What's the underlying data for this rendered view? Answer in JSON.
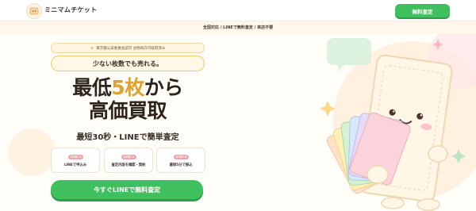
{
  "header": {
    "brand": "ミニマムチケット",
    "cta_label": "無料査定"
  },
  "subbar": {
    "text": "全国対応 / LINEで無料査定 / 来店不要"
  },
  "hero": {
    "license": "東京都公安委員会認可 古物商許可取得済み",
    "pill": "少ない枚数でも売れる。",
    "headline_pre": "最低",
    "headline_accent": "5枚",
    "headline_post": "から",
    "headline_line2": "高価買取",
    "subline": "最短30秒・LINEで簡単査定",
    "steps": [
      {
        "badge": "STEP 1",
        "label": "LINEで申込み"
      },
      {
        "badge": "STEP 2",
        "label": "査定内容を確認・契約"
      },
      {
        "badge": "STEP 3",
        "label": "最短5分で振込"
      }
    ],
    "cta_label": "今すぐLINEで無料査定"
  },
  "colors": {
    "accent_green": "#3fbf5e",
    "headline_accent": "#e1a12e",
    "step_badge": "#f3a3ad",
    "pill_border": "#f0c96b"
  },
  "icons": {
    "logo": "ticket-logo-icon",
    "license": "star-icon",
    "illustration": "ticket-mascot-illustration"
  }
}
